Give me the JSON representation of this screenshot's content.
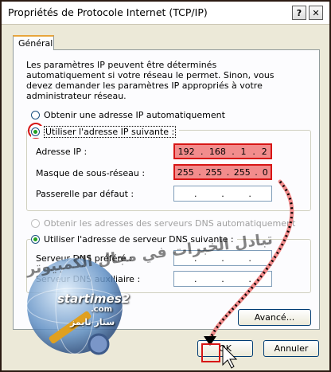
{
  "window": {
    "title": "Propriétés de Protocole Internet (TCP/IP)",
    "help_button": "?",
    "close_button": "✕"
  },
  "tab": {
    "label": "Général"
  },
  "intro_text": "Les paramètres IP peuvent être déterminés automatiquement si votre réseau le permet. Sinon, vous devez demander les paramètres IP appropriés à votre administrateur réseau.",
  "ip": {
    "auto_label": "Obtenir une adresse IP automatiquement",
    "manual_label": "Utiliser l'adresse IP suivante :",
    "selected": "manual",
    "address_label": "Adresse IP :",
    "address": [
      "192",
      "168",
      "1",
      "2"
    ],
    "mask_label": "Masque de sous-réseau :",
    "mask": [
      "255",
      "255",
      "255",
      "0"
    ],
    "gateway_label": "Passerelle par défaut :",
    "gateway": [
      "",
      "",
      "",
      ""
    ]
  },
  "dns": {
    "auto_label": "Obtenir les adresses des serveurs DNS automatiquement",
    "manual_label": "Utiliser l'adresse de serveur DNS suivante :",
    "preferred_label": "Serveur DNS préféré :",
    "alternate_label": "Serveur DNS auxiliaire :",
    "preferred": [
      "",
      "",
      "",
      ""
    ],
    "alternate": [
      "",
      "",
      "",
      ""
    ]
  },
  "buttons": {
    "advanced": "Avancé...",
    "ok": "OK",
    "cancel": "Annuler"
  },
  "watermark": {
    "site": "startimes2",
    "com": ".com",
    "arabic_small": "ستار تايمز",
    "arabic_large": "تبادل الخبرات في مجال الكمبيوتر"
  },
  "colors": {
    "highlight_fill": "#f28c8c",
    "highlight_border": "#d71616",
    "radio_dot": "#21a121",
    "window_border": "#2a1a12"
  }
}
